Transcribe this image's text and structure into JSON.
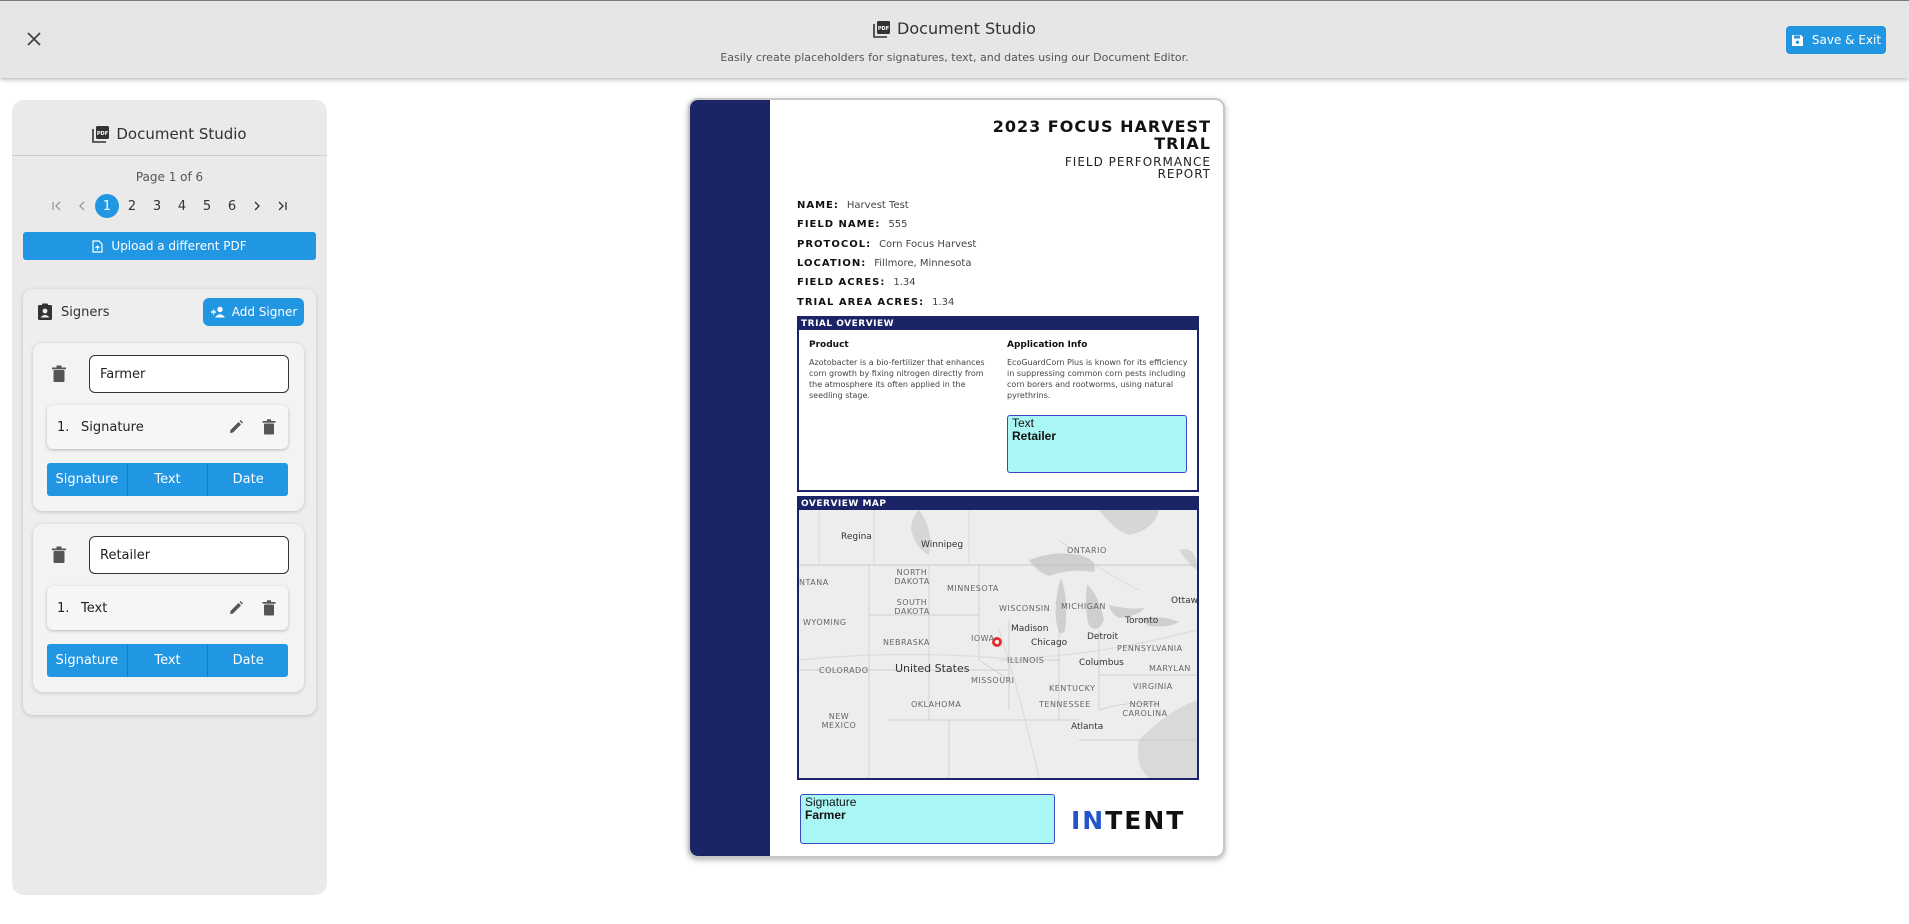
{
  "header": {
    "title": "Document Studio",
    "subtitle": "Easily create placeholders for signatures, text, and dates using our Document Editor.",
    "save_exit": "Save & Exit"
  },
  "sidebar": {
    "title": "Document Studio",
    "page_info": "Page 1 of 6",
    "pages": [
      "1",
      "2",
      "3",
      "4",
      "5",
      "6"
    ],
    "upload_label": "Upload a different PDF",
    "signers_label": "Signers",
    "add_signer": "Add Signer",
    "signers": [
      {
        "name": "Farmer",
        "fields": [
          {
            "num": "1.",
            "label": "Signature"
          }
        ]
      },
      {
        "name": "Retailer",
        "fields": [
          {
            "num": "1.",
            "label": "Text"
          }
        ]
      }
    ],
    "type_buttons": [
      "Signature",
      "Text",
      "Date"
    ]
  },
  "document": {
    "title_line1": "2023 FOCUS HARVEST",
    "title_line2": "TRIAL",
    "subtitle_line1": "FIELD PERFORMANCE",
    "subtitle_line2": "REPORT",
    "fields": [
      {
        "key": "NAME:",
        "value": "Harvest Test"
      },
      {
        "key": "FIELD NAME:",
        "value": "555"
      },
      {
        "key": "PROTOCOL:",
        "value": "Corn Focus Harvest"
      },
      {
        "key": "LOCATION:",
        "value": "Fillmore, Minnesota"
      },
      {
        "key": "FIELD ACRES:",
        "value": "1.34"
      },
      {
        "key": "TRIAL AREA ACRES:",
        "value": "1.34"
      }
    ],
    "overview_header": "TRIAL OVERVIEW",
    "product_heading": "Product",
    "product_text": "Azotobacter is a bio-fertilizer that enhances corn growth by fixing nitrogen directly from the atmosphere its often applied in the seedling stage.",
    "application_heading": "Application Info",
    "application_text": "EcoGuardCorn Plus is known for its efficiency in suppressing common corn pests including corn borers and rootworms, using natural pyrethrins.",
    "map_header": "OVERVIEW MAP",
    "map_labels": {
      "regina": "Regina",
      "winnipeg": "Winnipeg",
      "ontario": "ONTARIO",
      "montana": "NTANA",
      "north_dakota": "NORTH\nDAKOTA",
      "minnesota": "MINNESOTA",
      "south_dakota": "SOUTH\nDAKOTA",
      "wisconsin": "WISCONSIN",
      "michigan": "MICHIGAN",
      "ottawa": "Ottaw",
      "toronto": "Toronto",
      "wyoming": "WYOMING",
      "iowa": "IOWA",
      "madison": "Madison",
      "chicago": "Chicago",
      "detroit": "Detroit",
      "nebraska": "NEBRASKA",
      "pennsylvania": "PENNSYLVANIA",
      "illinois": "ILLINOIS",
      "columbus": "Columbus",
      "colorado": "COLORADO",
      "united_states": "United States",
      "missouri": "MISSOURI",
      "maryland": "MARYLAN",
      "kentucky": "KENTUCKY",
      "virginia": "VIRGINIA",
      "oklahoma": "OKLAHOMA",
      "tennessee": "TENNESSEE",
      "north_carolina": "NORTH\nCAROLINA",
      "new_mexico": "NEW\nMEXICO",
      "atlanta": "Atlanta"
    },
    "placeholders": [
      {
        "type": "Text",
        "signer": "Retailer"
      },
      {
        "type": "Signature",
        "signer": "Farmer"
      }
    ],
    "logo_in": "IN",
    "logo_rest": "TENT"
  }
}
